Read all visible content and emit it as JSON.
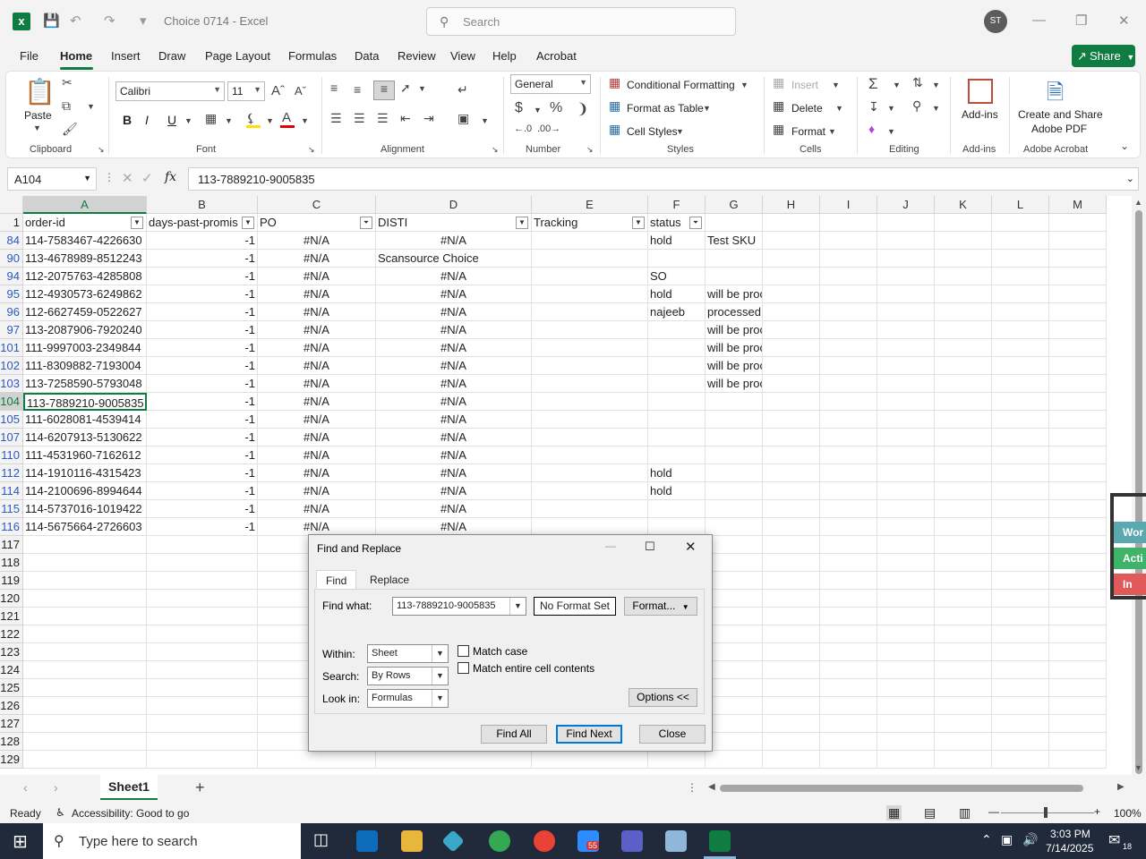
{
  "title_bar": {
    "doc_title": "Choice 0714  -  Excel",
    "search_placeholder": "Search",
    "avatar_initials": "ST"
  },
  "menu": {
    "items": [
      "File",
      "Home",
      "Insert",
      "Draw",
      "Page Layout",
      "Formulas",
      "Data",
      "Review",
      "View",
      "Help",
      "Acrobat"
    ],
    "active": "Home",
    "share_label": "Share"
  },
  "ribbon": {
    "clipboard": {
      "label": "Clipboard",
      "paste": "Paste"
    },
    "font": {
      "label": "Font",
      "name": "Calibri",
      "size": "11",
      "bold": "B",
      "italic": "I",
      "underline": "U"
    },
    "alignment": {
      "label": "Alignment"
    },
    "number": {
      "label": "Number",
      "format": "General"
    },
    "styles": {
      "label": "Styles",
      "conditional": "Conditional Formatting",
      "format_table": "Format as Table",
      "cell_styles": "Cell Styles"
    },
    "cells": {
      "label": "Cells",
      "insert": "Insert",
      "delete": "Delete",
      "format": "Format"
    },
    "editing": {
      "label": "Editing"
    },
    "addins": {
      "label": "Add-ins",
      "button": "Add-ins"
    },
    "acrobat": {
      "label": "Adobe Acrobat",
      "line1": "Create and Share",
      "line2": "Adobe PDF"
    }
  },
  "formula_bar": {
    "name_box": "A104",
    "fx": "fx",
    "content": "113-7889210-9005835"
  },
  "columns": [
    "A",
    "B",
    "C",
    "D",
    "E",
    "F",
    "G",
    "H",
    "I",
    "J",
    "K",
    "L",
    "M"
  ],
  "headers": {
    "A": "order-id",
    "B": "days-past-promis",
    "C": "PO",
    "D": "DISTI",
    "E": "Tracking",
    "F": "status"
  },
  "rows": [
    {
      "n": "84",
      "a": "114-7583467-4226630",
      "b": "-1",
      "c": "#N/A",
      "d": "#N/A",
      "f": "hold",
      "g": "Test SKU"
    },
    {
      "n": "90",
      "a": "113-4678989-8512243",
      "b": "-1",
      "c": "#N/A",
      "d": "Scansource Choice",
      "f": "",
      "g": ""
    },
    {
      "n": "94",
      "a": "112-2075763-4285808",
      "b": "-1",
      "c": "#N/A",
      "d": "#N/A",
      "f": "SO",
      "g": ""
    },
    {
      "n": "95",
      "a": "112-4930573-6249862",
      "b": "-1",
      "c": "#N/A",
      "d": "#N/A",
      "f": "hold",
      "g": "will be processed"
    },
    {
      "n": "96",
      "a": "112-6627459-0522627",
      "b": "-1",
      "c": "#N/A",
      "d": "#N/A",
      "f": "najeeb",
      "g": "processed"
    },
    {
      "n": "97",
      "a": "113-2087906-7920240",
      "b": "-1",
      "c": "#N/A",
      "d": "#N/A",
      "f": "",
      "g": "will be processed"
    },
    {
      "n": "101",
      "a": "111-9997003-2349844",
      "b": "-1",
      "c": "#N/A",
      "d": "#N/A",
      "f": "",
      "g": "will be processed"
    },
    {
      "n": "102",
      "a": "111-8309882-7193004",
      "b": "-1",
      "c": "#N/A",
      "d": "#N/A",
      "f": "",
      "g": "will be processed"
    },
    {
      "n": "103",
      "a": "113-7258590-5793048",
      "b": "-1",
      "c": "#N/A",
      "d": "#N/A",
      "f": "",
      "g": "will be processed"
    },
    {
      "n": "104",
      "a": "113-7889210-9005835",
      "b": "-1",
      "c": "#N/A",
      "d": "#N/A",
      "f": "",
      "g": ""
    },
    {
      "n": "105",
      "a": "111-6028081-4539414",
      "b": "-1",
      "c": "#N/A",
      "d": "#N/A",
      "f": "",
      "g": ""
    },
    {
      "n": "107",
      "a": "114-6207913-5130622",
      "b": "-1",
      "c": "#N/A",
      "d": "#N/A",
      "f": "",
      "g": ""
    },
    {
      "n": "110",
      "a": "111-4531960-7162612",
      "b": "-1",
      "c": "#N/A",
      "d": "#N/A",
      "f": "",
      "g": ""
    },
    {
      "n": "112",
      "a": "114-1910116-4315423",
      "b": "-1",
      "c": "#N/A",
      "d": "#N/A",
      "f": "hold",
      "g": ""
    },
    {
      "n": "114",
      "a": "114-2100696-8994644",
      "b": "-1",
      "c": "#N/A",
      "d": "#N/A",
      "f": "hold",
      "g": ""
    },
    {
      "n": "115",
      "a": "114-5737016-1019422",
      "b": "-1",
      "c": "#N/A",
      "d": "#N/A",
      "f": "",
      "g": ""
    },
    {
      "n": "116",
      "a": "114-5675664-2726603",
      "b": "-1",
      "c": "#N/A",
      "d": "#N/A",
      "f": "",
      "g": ""
    }
  ],
  "empty_rows": [
    "117",
    "118",
    "119",
    "120",
    "121",
    "122",
    "123",
    "124",
    "125",
    "126",
    "127",
    "128",
    "129"
  ],
  "sheet_tabs": {
    "active": "Sheet1",
    "add": "+"
  },
  "status_bar": {
    "ready": "Ready",
    "accessibility": "Accessibility: Good to go",
    "zoom": "100%"
  },
  "taskbar": {
    "search_placeholder": "Type here to search",
    "time": "3:03 PM",
    "date": "7/14/2025",
    "zoom_badge": "55",
    "notif_count": "18"
  },
  "side_peek": [
    "Wor",
    "Acti",
    "In Ac"
  ],
  "dialog": {
    "title": "Find and Replace",
    "tab_find": "Find",
    "tab_replace": "Replace",
    "find_what_label": "Find what:",
    "find_what_value": "113-7889210-9005835",
    "no_format": "No Format Set",
    "format_btn": "Format...",
    "within_label": "Within:",
    "within_value": "Sheet",
    "search_label": "Search:",
    "search_value": "By Rows",
    "lookin_label": "Look in:",
    "lookin_value": "Formulas",
    "match_case": "Match case",
    "match_entire": "Match entire cell contents",
    "options_btn": "Options << ",
    "find_all": "Find All",
    "find_next": "Find Next",
    "close": "Close"
  },
  "colors": {
    "excel_green": "#107c41",
    "filtered_row_blue": "#2b58c4",
    "taskbar": "#202a3a"
  }
}
